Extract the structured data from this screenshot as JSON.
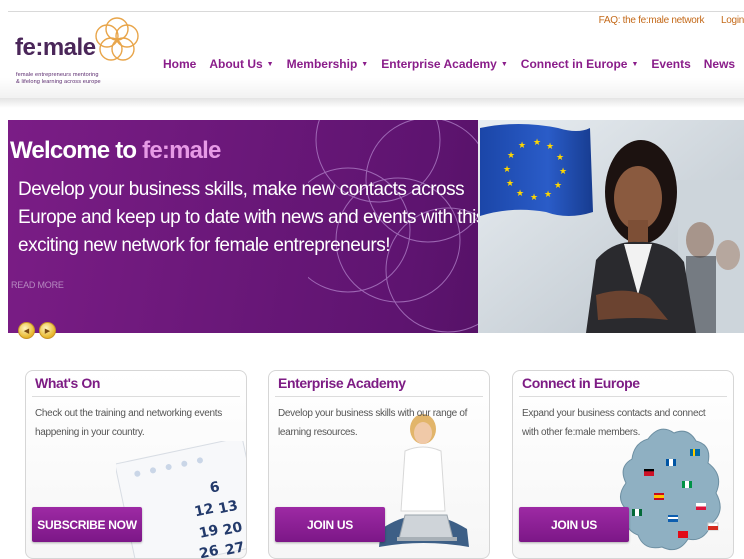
{
  "utility": {
    "faq": "FAQ: the fe:male network",
    "login": "Login"
  },
  "logo": {
    "name": "fe:male",
    "tagline_1": "female entrepreneurs mentoring",
    "tagline_2": "& lifelong learning across europe"
  },
  "nav": [
    {
      "label": "Home",
      "has_menu": false
    },
    {
      "label": "About Us",
      "has_menu": true
    },
    {
      "label": "Membership",
      "has_menu": true
    },
    {
      "label": "Enterprise Academy",
      "has_menu": true
    },
    {
      "label": "Connect in Europe",
      "has_menu": true
    },
    {
      "label": "Events",
      "has_menu": false
    },
    {
      "label": "News",
      "has_menu": false
    }
  ],
  "hero": {
    "title_prefix": "Welcome to",
    "title_accent": "fe:male",
    "body": "Develop your business skills, make new contacts across Europe and keep up to date with news and events with this exciting new network for female entrepreneurs!",
    "read_more": "READ MORE"
  },
  "boxes": [
    {
      "title": "What's On",
      "text": "Check out the training and networking events happening in your country.",
      "button": "SUBSCRIBE NOW"
    },
    {
      "title": "Enterprise Academy",
      "text": "Develop your business skills with our range of learning resources.",
      "button": "JOIN US"
    },
    {
      "title": "Connect in Europe",
      "text": "Expand your business contacts and connect with other fe:male members.",
      "button": "JOIN US"
    }
  ],
  "calendar_numbers": [
    "6",
    "12",
    "13",
    "19",
    "20",
    "26",
    "27"
  ],
  "colors": {
    "brand_purple": "#7d1c84",
    "hero_purple": "#5e1470",
    "accent_pink": "#e79ae6",
    "utility_orange": "#c46a1a",
    "eu_blue": "#1f4fb8",
    "eu_star": "#ffd700"
  }
}
